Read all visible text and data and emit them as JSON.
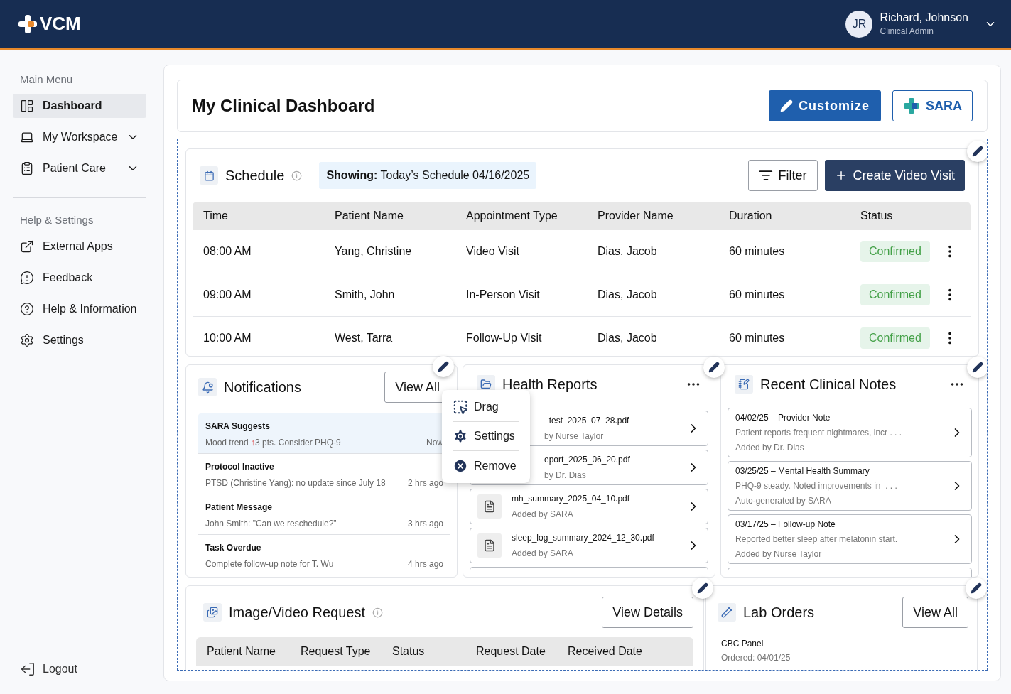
{
  "header": {
    "logo": "VCM",
    "user": {
      "initials": "JR",
      "name": "Richard, Johnson",
      "role": "Clinical Admin",
      "expanded": false
    }
  },
  "sidebar": {
    "sections": [
      {
        "title": "Main Menu",
        "items": [
          {
            "label": "Dashboard",
            "kind": "link",
            "selected": true
          },
          {
            "label": "My Workspace",
            "kind": "group",
            "expanded": false,
            "selected": false
          },
          {
            "label": "Patient Care",
            "kind": "group",
            "expanded": false,
            "selected": false
          }
        ]
      },
      {
        "title": "Help & Settings",
        "items": [
          {
            "label": "External Apps",
            "kind": "link",
            "selected": false
          },
          {
            "label": "Feedback",
            "kind": "link",
            "selected": false
          },
          {
            "label": "Help & Information",
            "kind": "link",
            "selected": false
          },
          {
            "label": "Settings",
            "kind": "link",
            "selected": false
          }
        ]
      }
    ],
    "logout": "Logout"
  },
  "page": {
    "title": "My Clinical Dashboard",
    "buttons": [
      "Customize",
      "SARA"
    ]
  },
  "schedule": {
    "title": "Schedule",
    "showing_label": "Showing:",
    "showing_value": "Today’s Schedule 04/16/2025",
    "filter": "Filter",
    "create": "Create Video Visit",
    "columns": [
      "Time",
      "Patient Name",
      "Appointment Type",
      "Provider Name",
      "Duration",
      "Status"
    ],
    "rows": [
      {
        "cells": [
          "08:00 AM",
          "Yang, Christine",
          "Video Visit",
          "Dias, Jacob",
          "60 minutes"
        ],
        "status": "Confirmed"
      },
      {
        "cells": [
          "09:00 AM",
          "Smith, John",
          "In-Person Visit",
          "Dias, Jacob",
          "60 minutes"
        ],
        "status": "Confirmed"
      },
      {
        "cells": [
          "10:00 AM",
          "West, Tarra",
          "Follow-Up Visit",
          "Dias, Jacob",
          "60 minutes"
        ],
        "status": "Confirmed"
      }
    ]
  },
  "notifications": {
    "title": "Notifications",
    "view_all": "View All",
    "items": [
      {
        "title": "SARA Suggests",
        "text": "Mood trend ",
        "trend_mark": "↑",
        "text_rest": "3 pts. Consider PHQ-9",
        "time": "Now",
        "highlighted": true
      },
      {
        "title": "Protocol Inactive",
        "text": "PTSD (Christine Yang): no update since July 18",
        "time": "2 hrs ago",
        "highlighted": false
      },
      {
        "title": "Patient Message",
        "text": "John Smith: \"Can we reschedule?\"",
        "time": "3 hrs ago",
        "highlighted": false
      },
      {
        "title": "Task Overdue",
        "text": "Complete follow-up note for T. Wu",
        "time": "4 hrs ago",
        "highlighted": false
      }
    ]
  },
  "widget_menu": {
    "items": [
      "Drag",
      "Settings",
      "Remove"
    ]
  },
  "health_reports": {
    "title": "Health Reports",
    "items": [
      {
        "name": "_test_2025_07_28.pdf",
        "added_by": "by Nurse Taylor",
        "covered": true
      },
      {
        "name": "eport_2025_06_20.pdf",
        "added_by": "by Dr. Dias",
        "covered": true
      },
      {
        "name": "mh_summary_2025_04_10.pdf",
        "added_by": "Added by SARA",
        "covered": false
      },
      {
        "name": "sleep_log_summary_2024_12_30.pdf",
        "added_by": "Added by SARA",
        "covered": false
      }
    ]
  },
  "clinical_notes": {
    "title": "Recent Clinical Notes",
    "items": [
      {
        "title": "04/02/25 – Provider Note",
        "text": "Patient reports frequent nightmares, incr . . .",
        "added_by": "Added by Dr. Dias"
      },
      {
        "title": "03/25/25 – Mental Health Summary",
        "text": "PHQ-9 steady. Noted improvements in  . . .",
        "added_by": "Auto-generated by SARA"
      },
      {
        "title": "03/17/25 – Follow-up Note",
        "text": "Reported better sleep after melatonin start.",
        "added_by": "Added by Nurse Taylor"
      }
    ]
  },
  "image_video_request": {
    "title": "Image/Video Request",
    "view_details": "View Details",
    "columns": [
      "Patient Name",
      "Request Type",
      "Status",
      "Request Date",
      "Received Date"
    ]
  },
  "lab_orders": {
    "title": "Lab Orders",
    "view_all": "View All",
    "items": [
      {
        "name": "CBC Panel",
        "ordered": "Ordered: 04/01/25"
      }
    ]
  }
}
